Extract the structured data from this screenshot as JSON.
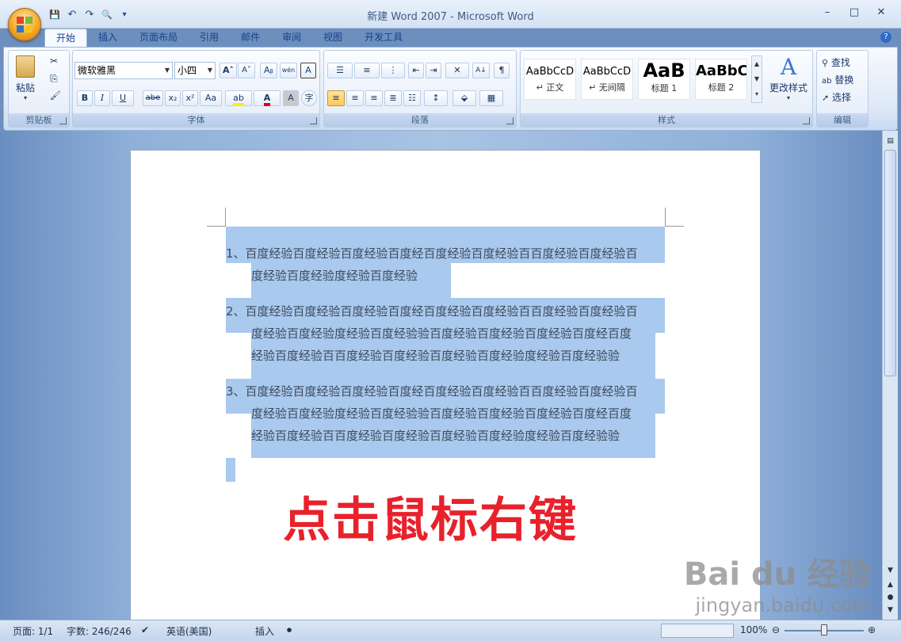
{
  "window": {
    "title": "新建 Word 2007 - Microsoft Word",
    "minimize": "–",
    "maximize": "□",
    "close": "✕"
  },
  "qat": {
    "save": "💾",
    "undo": "↶",
    "redo": "↷",
    "print_preview": "🔍",
    "customize": "▾"
  },
  "tabs": [
    "开始",
    "插入",
    "页面布局",
    "引用",
    "邮件",
    "审阅",
    "视图",
    "开发工具"
  ],
  "help": "?",
  "ribbon": {
    "clipboard": {
      "label": "剪贴板",
      "paste": "粘贴",
      "cut": "✂",
      "copy": "⎘",
      "format_painter": "🖌"
    },
    "font": {
      "label": "字体",
      "font_name": "微软雅黑",
      "font_size": "小四",
      "grow": "A˄",
      "shrink": "A˅",
      "clear": "Aᵦ",
      "phonetic": "wén",
      "border": "A",
      "bold": "B",
      "italic": "I",
      "underline": "U",
      "strike": "abe",
      "subscript": "x₂",
      "superscript": "x²",
      "case": "Aa",
      "highlight": "ab",
      "font_color": "A",
      "shading": "A",
      "enclose": "字"
    },
    "paragraph": {
      "label": "段落",
      "bullets": "☰",
      "numbering": "≡",
      "multilevel": "⋮",
      "sort": "A↓",
      "marks": "¶"
    },
    "styles": {
      "label": "样式",
      "tiles": [
        {
          "sample": "AaBbCcD",
          "name": "↵ 正文"
        },
        {
          "sample": "AaBbCcD",
          "name": "↵ 无间隔"
        },
        {
          "sample": "AaB",
          "name": "标题 1"
        },
        {
          "sample": "AaBbC",
          "name": "标题 2"
        }
      ],
      "change": "更改样式"
    },
    "editing": {
      "label": "编辑",
      "find": "查找",
      "replace": "替换",
      "select": "选择"
    }
  },
  "document": {
    "lines": [
      "1、百度经验百度经验百度经验百度经百度经验百度经验百百度经验百度经验百",
      "度经验百度经验度经验百度经验",
      "2、百度经验百度经验百度经验百度经百度经验百度经验百百度经验百度经验百",
      "度经验百度经验度经验百度经验验百度经验百度经验百度经验百度经百度",
      "经验百度经验百百度经验百度经验百度经验百度经验度经验百度经验验",
      "3、百度经验百度经验百度经验百度经百度经验百度经验百百度经验百度经验百",
      "度经验百度经验度经验百度经验验百度经验百度经验百度经验百度经百度",
      "经验百度经验百百度经验百度经验百度经验百度经验度经验百度经验验"
    ],
    "overlay_text": "点击鼠标右键",
    "watermark_big": "Bai du 经验",
    "watermark_small": "jingyan.baidu.com"
  },
  "status": {
    "page": "页面: 1/1",
    "words": "字数: 246/246",
    "language": "英语(美国)",
    "mode": "插入",
    "zoom": "100%",
    "zoom_level": 0.5
  }
}
